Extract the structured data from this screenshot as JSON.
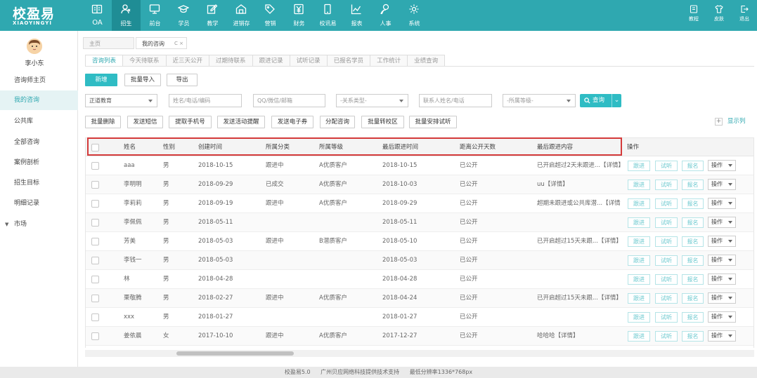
{
  "brand": {
    "name_cn": "校盈易",
    "name_en": "XIAOYINGYI",
    "accent": "#2fa8b0",
    "button_color": "#2fbcc4"
  },
  "nav": [
    {
      "label": "OA",
      "icon": "oa-icon"
    },
    {
      "label": "招生",
      "icon": "enroll-icon",
      "active": true
    },
    {
      "label": "前台",
      "icon": "monitor-icon"
    },
    {
      "label": "学员",
      "icon": "graduation-cap-icon"
    },
    {
      "label": "教学",
      "icon": "edit-icon"
    },
    {
      "label": "进销存",
      "icon": "warehouse-icon"
    },
    {
      "label": "营销",
      "icon": "tag-icon"
    },
    {
      "label": "财务",
      "icon": "yen-icon"
    },
    {
      "label": "校讯易",
      "icon": "mobile-icon"
    },
    {
      "label": "报表",
      "icon": "chart-icon"
    },
    {
      "label": "人事",
      "icon": "person-icon"
    },
    {
      "label": "系统",
      "icon": "gear-icon"
    }
  ],
  "top_right": [
    {
      "label": "教程",
      "icon": "book-icon"
    },
    {
      "label": "皮肤",
      "icon": "shirt-icon"
    },
    {
      "label": "退出",
      "icon": "logout-icon"
    }
  ],
  "user": {
    "name": "李小东"
  },
  "sidebar": [
    {
      "label": "咨询师主页"
    },
    {
      "label": "我的咨询",
      "active": true
    },
    {
      "label": "公共库"
    },
    {
      "label": "全部咨询"
    },
    {
      "label": "案例剖析"
    },
    {
      "label": "招生目标"
    },
    {
      "label": "明细记录"
    },
    {
      "label": "市场",
      "expandable": true
    }
  ],
  "page_tabs": [
    {
      "label": "主页"
    },
    {
      "label": "我的咨询",
      "active": true,
      "close": "C ×"
    }
  ],
  "sub_tabs": [
    "咨询列表",
    "今天待联系",
    "近三天公开",
    "过期待联系",
    "跟进记录",
    "试听记录",
    "已报名学员",
    "工作统计",
    "业绩查询"
  ],
  "actions1": {
    "add": "新增",
    "batch_import": "批量导入",
    "export": "导出"
  },
  "filters": {
    "campus": "正道教育",
    "name_placeholder": "姓名/电话/编码",
    "contact_placeholder": "QQ/微信/邮箱",
    "relation_type": "-关系类型-",
    "contact_person_placeholder": "联系人姓名/电话",
    "level": "-所属等级-",
    "query": "查询"
  },
  "actions2": [
    "批量删除",
    "发送短信",
    "提取手机号",
    "发送活动提醒",
    "发送电子券",
    "分配咨询",
    "批量转校区",
    "批量安排试听"
  ],
  "show_columns": "显示列",
  "table": {
    "headers": {
      "name": "姓名",
      "gender": "性别",
      "created": "创建时间",
      "category": "所属分类",
      "level": "所属等级",
      "last_follow": "最后跟进时间",
      "days_public": "距离公开天数",
      "last_content": "最后跟进内容",
      "ops": "操作"
    },
    "row_buttons": {
      "follow": "跟进",
      "trial": "试听",
      "enroll": "报名",
      "op": "操作"
    },
    "rows": [
      {
        "name": "aaa",
        "gender": "男",
        "created": "2018-10-15",
        "category": "跟进中",
        "level": "A优质客户",
        "last_follow": "2018-10-15",
        "days_public": "已公开",
        "last_content": "已开启超过2天未跟进...【详情】"
      },
      {
        "name": "李明明",
        "gender": "男",
        "created": "2018-09-29",
        "category": "已成交",
        "level": "A优质客户",
        "last_follow": "2018-10-03",
        "days_public": "已公开",
        "last_content": "uu【详情】"
      },
      {
        "name": "李莉莉",
        "gender": "男",
        "created": "2018-09-19",
        "category": "跟进中",
        "level": "A优质客户",
        "last_follow": "2018-09-29",
        "days_public": "已公开",
        "last_content": "超期未跟进或公共库潜...【详情"
      },
      {
        "name": "李佩佩",
        "gender": "男",
        "created": "2018-05-11",
        "category": "",
        "level": "",
        "last_follow": "2018-05-11",
        "days_public": "已公开",
        "last_content": ""
      },
      {
        "name": "芳美",
        "gender": "男",
        "created": "2018-05-03",
        "category": "跟进中",
        "level": "B潜质客户",
        "last_follow": "2018-05-10",
        "days_public": "已公开",
        "last_content": "已开启超过15天未跟...【详情】"
      },
      {
        "name": "李钱一",
        "gender": "男",
        "created": "2018-05-03",
        "category": "",
        "level": "",
        "last_follow": "2018-05-03",
        "days_public": "已公开",
        "last_content": ""
      },
      {
        "name": "林",
        "gender": "男",
        "created": "2018-04-28",
        "category": "",
        "level": "",
        "last_follow": "2018-04-28",
        "days_public": "已公开",
        "last_content": ""
      },
      {
        "name": "栗敬腾",
        "gender": "男",
        "created": "2018-02-27",
        "category": "跟进中",
        "level": "A优质客户",
        "last_follow": "2018-04-24",
        "days_public": "已公开",
        "last_content": "已开启超过15天未跟...【详情】"
      },
      {
        "name": "xxx",
        "gender": "男",
        "created": "2018-01-27",
        "category": "",
        "level": "",
        "last_follow": "2018-01-27",
        "days_public": "已公开",
        "last_content": ""
      },
      {
        "name": "姜依晨",
        "gender": "女",
        "created": "2017-10-10",
        "category": "跟进中",
        "level": "A优质客户",
        "last_follow": "2017-12-27",
        "days_public": "已公开",
        "last_content": "哈哈哈【详情】"
      }
    ]
  },
  "footer": {
    "version": "校盈易5.0",
    "support": "广州贝应网络科技提供技术支持",
    "resolution": "最低分辨率1336*768px"
  }
}
